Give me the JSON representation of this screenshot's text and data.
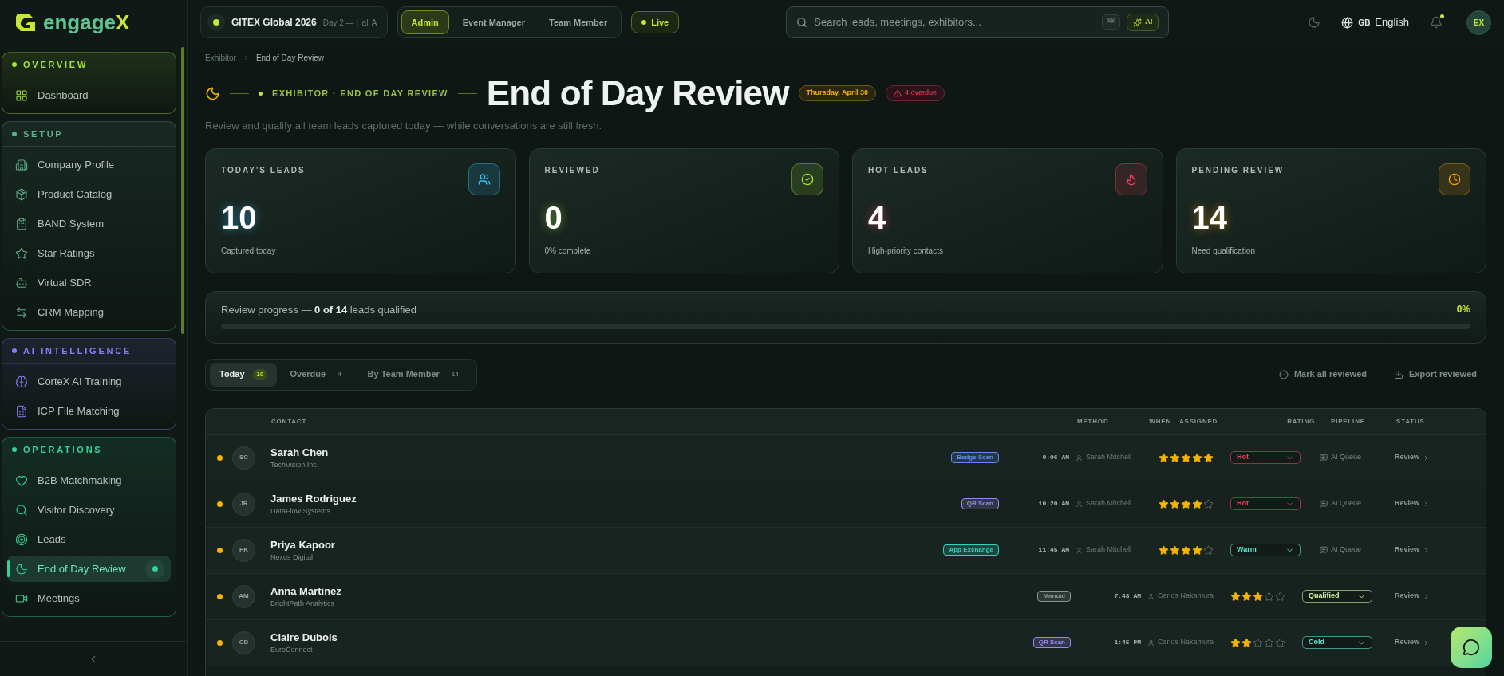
{
  "brand": {
    "name": "engage",
    "accent": "X"
  },
  "event": {
    "name": "GITEX Global 2026",
    "detail": "Day 2 — Hall A"
  },
  "roles": [
    {
      "label": "Admin",
      "selected": true
    },
    {
      "label": "Event Manager",
      "selected": false
    },
    {
      "label": "Team Member",
      "selected": false
    }
  ],
  "live": {
    "label": "Live"
  },
  "search": {
    "placeholder": "Search leads, meetings, exhibitors...",
    "shortcut": "⌘K",
    "ai": "AI"
  },
  "language": {
    "flag": "GB",
    "label": "English"
  },
  "notifications": {
    "unread": true
  },
  "avatar": "EX",
  "sidebar": {
    "sections": [
      {
        "title": "OVERVIEW",
        "color": "#a3e635",
        "items": [
          {
            "label": "Dashboard",
            "selected": false
          }
        ]
      },
      {
        "title": "SETUP",
        "color": "#5fae8e",
        "items": [
          {
            "label": "Company Profile",
            "selected": false
          },
          {
            "label": "Product Catalog",
            "selected": false
          },
          {
            "label": "BAND System",
            "selected": false
          },
          {
            "label": "Star Ratings",
            "selected": false
          },
          {
            "label": "Virtual SDR",
            "selected": false
          },
          {
            "label": "CRM Mapping",
            "selected": false
          }
        ]
      },
      {
        "title": "AI INTELLIGENCE",
        "color": "#8b7cf6",
        "items": [
          {
            "label": "CorteX AI Training",
            "selected": false
          },
          {
            "label": "ICP File Matching",
            "selected": false
          }
        ]
      },
      {
        "title": "OPERATIONS",
        "color": "#34d399",
        "items": [
          {
            "label": "B2B Matchmaking",
            "selected": false
          },
          {
            "label": "Visitor Discovery",
            "selected": false
          },
          {
            "label": "Leads",
            "selected": false
          },
          {
            "label": "End of Day Review",
            "selected": true
          },
          {
            "label": "Meetings",
            "selected": false
          }
        ]
      }
    ]
  },
  "breadcrumb": [
    "Exhibitor",
    "End of Day Review"
  ],
  "page": {
    "eyebrow": "EXHIBITOR · END OF DAY REVIEW",
    "title": "End of Day Review",
    "date": "Thursday, April 30",
    "overdue": "4 overdue",
    "subtitle": "Review and qualify all team leads captured today — while conversations are still fresh."
  },
  "stats": [
    {
      "title": "TODAY'S LEADS",
      "value": "10",
      "caption": "Captured today",
      "color": "#38bdf8"
    },
    {
      "title": "REVIEWED",
      "value": "0",
      "caption": "0% complete",
      "color": "#a3e635"
    },
    {
      "title": "HOT LEADS",
      "value": "4",
      "caption": "High-priority contacts",
      "color": "#f43f5e"
    },
    {
      "title": "PENDING REVIEW",
      "value": "14",
      "caption": "Need qualification",
      "color": "#f59e0b"
    }
  ],
  "progress": {
    "label": "Review progress — **0 of 14** leads qualified",
    "percent": "0%",
    "level": 0
  },
  "tabs": [
    {
      "label": "Today",
      "count": "10",
      "selected": true
    },
    {
      "label": "Overdue",
      "count": "4",
      "selected": false
    },
    {
      "label": "By Team Member",
      "count": "14",
      "selected": false
    }
  ],
  "actions": [
    "Mark all reviewed",
    "Export reviewed"
  ],
  "table": {
    "columns": [
      "CONTACT",
      "METHOD",
      "WHEN",
      "ASSIGNED",
      "RATING",
      "PIPELINE",
      "STATUS"
    ],
    "rows": [
      {
        "initials": "SC",
        "name": "Sarah Chen",
        "company": "TechVision Inc.",
        "color": "#f5b400",
        "method": {
          "label": "Badge Scan",
          "color": "#5b8def"
        },
        "when": "9:06 AM",
        "assigned": "Sarah Mitchell",
        "stars": 5,
        "rating": {
          "label": "Hot",
          "color": "#f43f5e"
        },
        "pipeline": "AI Queue",
        "status": "Review"
      },
      {
        "initials": "JR",
        "name": "James Rodriguez",
        "company": "DataFlow Systems",
        "color": "#f5b400",
        "method": {
          "label": "QR Scan",
          "color": "#9b87f5"
        },
        "when": "10:20 AM",
        "assigned": "Sarah Mitchell",
        "stars": 4,
        "rating": {
          "label": "Hot",
          "color": "#f43f5e"
        },
        "pipeline": "AI Queue",
        "status": "Review"
      },
      {
        "initials": "PK",
        "name": "Priya Kapoor",
        "company": "Nexus Digital",
        "color": "#f5b400",
        "method": {
          "label": "App Exchange",
          "color": "#2dd4bf"
        },
        "when": "11:45 AM",
        "assigned": "Sarah Mitchell",
        "stars": 4,
        "rating": {
          "label": "Warm",
          "color": "#5eead4"
        },
        "pipeline": "AI Queue",
        "status": "Review"
      },
      {
        "initials": "AM",
        "name": "Anna Martinez",
        "company": "BrightPath Analytics",
        "color": "#f5b400",
        "method": {
          "label": "Manual",
          "color": "#8a9490"
        },
        "when": "7:48 AM",
        "assigned": "Carlos Nakamura",
        "stars": 3,
        "rating": {
          "label": "Qualified",
          "color": "#d9f99d"
        },
        "status": "Review"
      },
      {
        "initials": "CD",
        "name": "Claire Dubois",
        "company": "EuroConnect",
        "color": "#f5b400",
        "method": {
          "label": "QR Scan",
          "color": "#9b87f5"
        },
        "when": "1:45 PM",
        "assigned": "Carlos Nakamura",
        "stars": 2,
        "rating": {
          "label": "Cold",
          "color": "#5eead4"
        },
        "status": "Review"
      }
    ]
  }
}
